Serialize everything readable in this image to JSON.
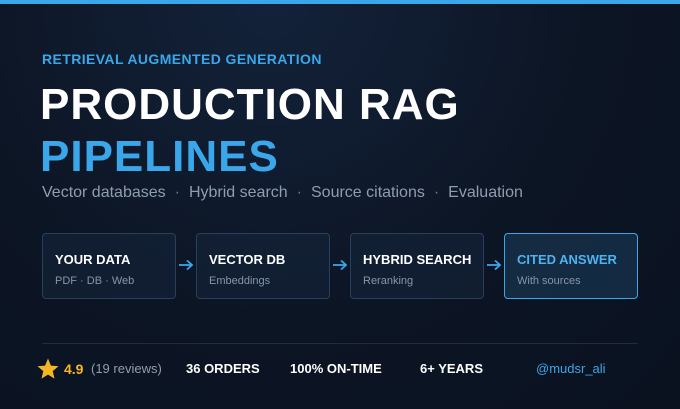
{
  "header": {
    "eyebrow": "RETRIEVAL AUGMENTED GENERATION",
    "title_line1": "PRODUCTION RAG",
    "title_line2": "PIPELINES"
  },
  "subtitle": {
    "items": [
      "Vector databases",
      "Hybrid search",
      "Source citations",
      "Evaluation"
    ],
    "separator": "·"
  },
  "pipeline": {
    "steps": [
      {
        "title": "YOUR DATA",
        "subtitle": "PDF · DB · Web"
      },
      {
        "title": "VECTOR DB",
        "subtitle": "Embeddings"
      },
      {
        "title": "HYBRID SEARCH",
        "subtitle": "Reranking"
      },
      {
        "title": "CITED ANSWER",
        "subtitle": "With sources"
      }
    ],
    "arrow_icon": "arrow-right-icon"
  },
  "stats": {
    "rating": "4.9",
    "reviews": "(19 reviews)",
    "orders": "36 ORDERS",
    "on_time": "100% ON-TIME",
    "years": "6+ YEARS",
    "handle": "@mudsr_ali"
  },
  "colors": {
    "accent": "#3aa7ea",
    "star": "#f4b623",
    "background": "#0c1524",
    "muted_text": "#8f9db0"
  }
}
